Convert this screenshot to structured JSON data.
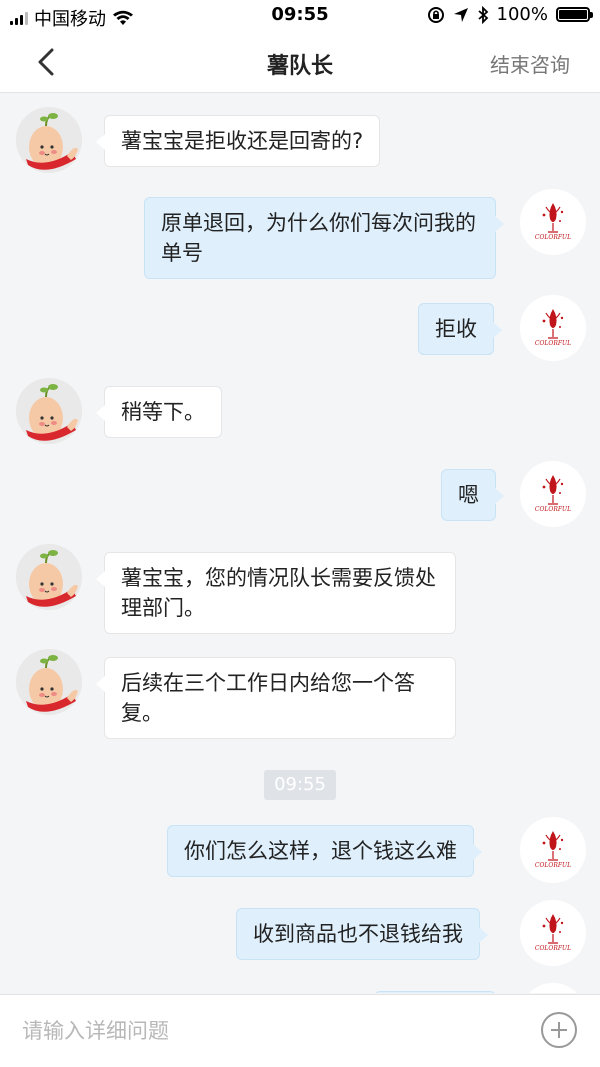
{
  "status": {
    "carrier": "中国移动",
    "time": "09:55",
    "battery": "100%"
  },
  "nav": {
    "title": "薯队长",
    "end_label": "结束咨询"
  },
  "messages": [
    {
      "side": "left",
      "text": "薯宝宝是拒收还是回寄的?"
    },
    {
      "side": "right",
      "text": "原单退回，为什么你们每次问我的单号"
    },
    {
      "side": "right",
      "text": "拒收"
    },
    {
      "side": "left",
      "text": "稍等下。"
    },
    {
      "side": "right",
      "text": "嗯"
    },
    {
      "side": "left",
      "text": "薯宝宝，您的情况队长需要反馈处理部门。"
    },
    {
      "side": "left",
      "text": "后续在三个工作日内给您一个答复。"
    },
    {
      "side": "right",
      "text": "你们怎么这样，退个钱这么难"
    },
    {
      "side": "right",
      "text": "收到商品也不退钱给我"
    }
  ],
  "chat_timestamp": "09:55",
  "avatar_brand_text": "COLORFUL",
  "input": {
    "placeholder": "请输入详细问题",
    "value": ""
  },
  "colors": {
    "bubble_right": "#dff0fc",
    "bubble_left": "#ffffff",
    "background": "#f4f5f7",
    "brand_red": "#c0151b"
  }
}
